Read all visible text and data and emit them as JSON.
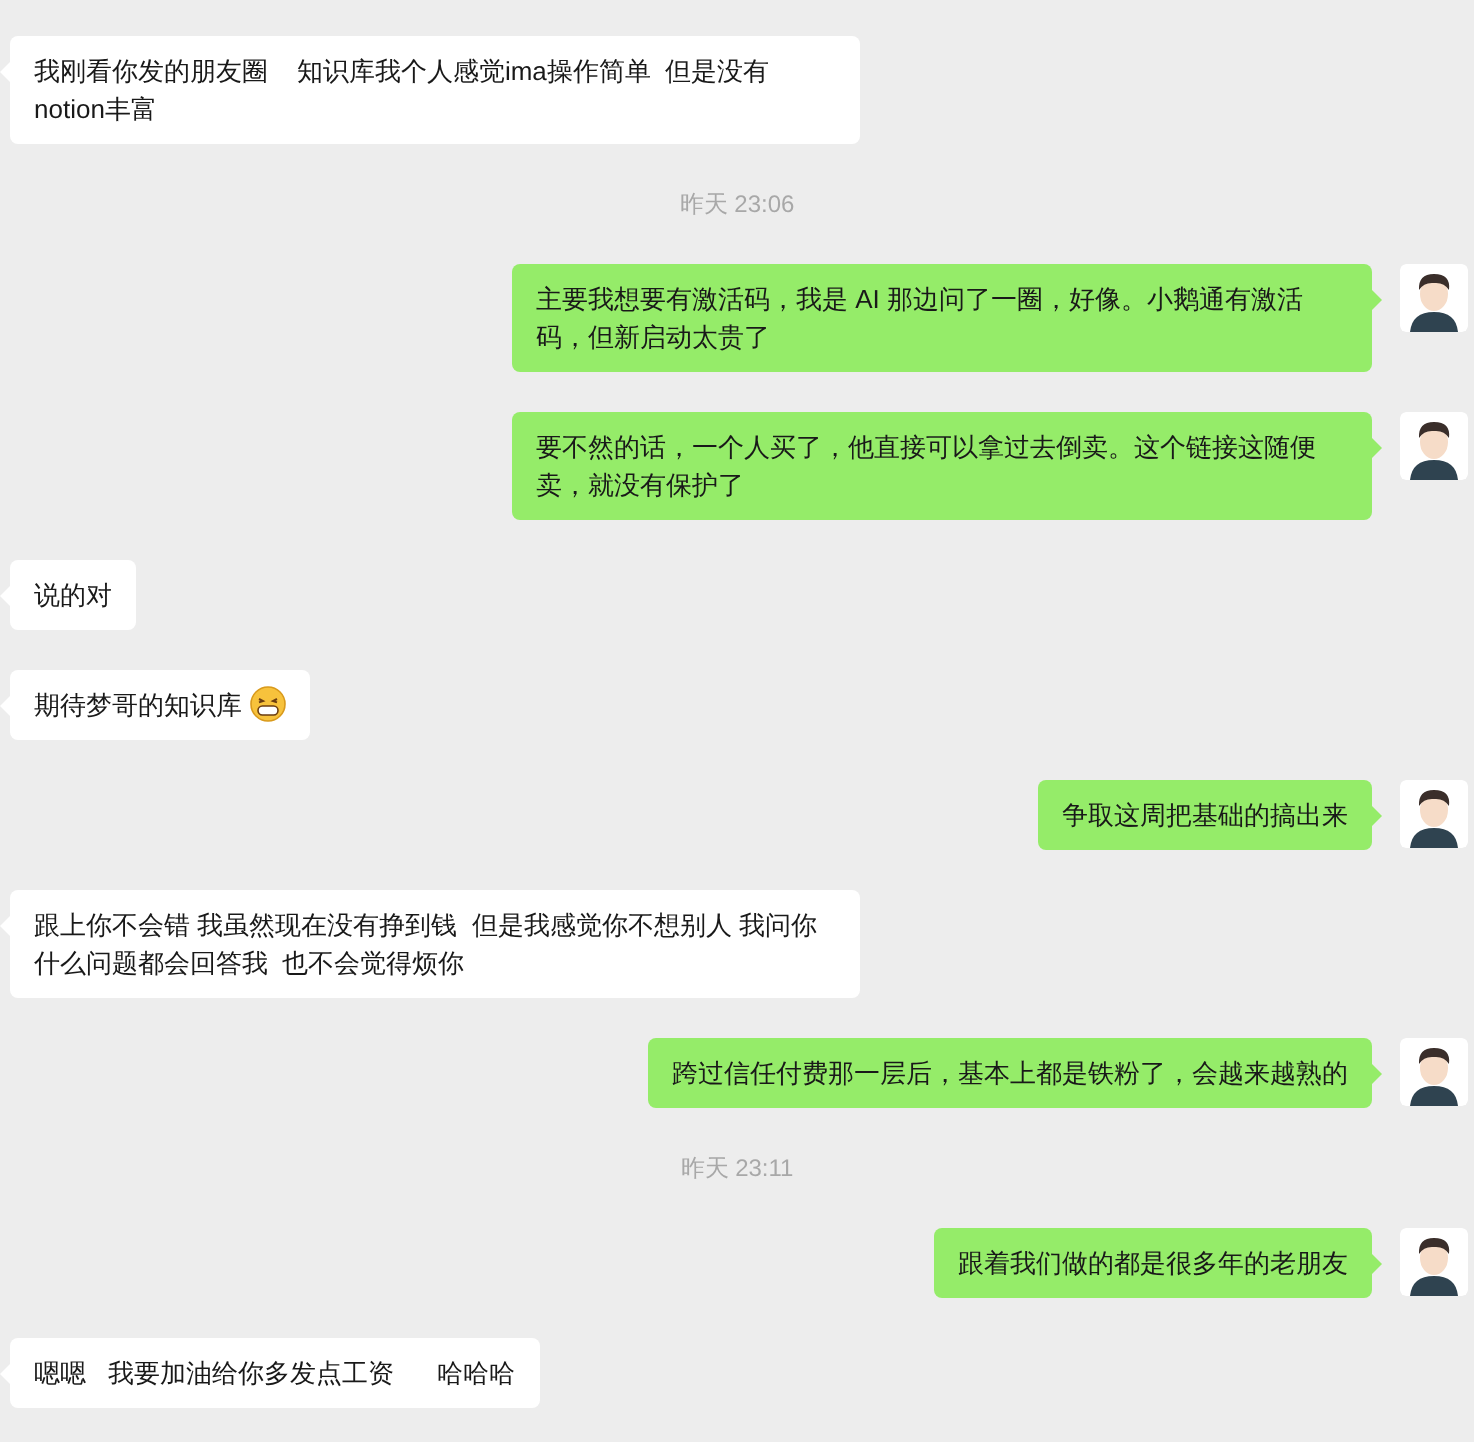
{
  "messages": [
    {
      "kind": "in",
      "text": "我刚看你发的朋友圈    知识库我个人感觉ima操作简单  但是没有notion丰富"
    },
    {
      "kind": "time",
      "text": "昨天 23:06"
    },
    {
      "kind": "out",
      "text": "主要我想要有激活码，我是 AI 那边问了一圈，好像。小鹅通有激活码，但新启动太贵了"
    },
    {
      "kind": "out",
      "text": "要不然的话，一个人买了，他直接可以拿过去倒卖。这个链接这随便卖，就没有保护了"
    },
    {
      "kind": "in",
      "text": "说的对"
    },
    {
      "kind": "in",
      "text": "期待梦哥的知识库",
      "emoji": true
    },
    {
      "kind": "out",
      "text": "争取这周把基础的搞出来"
    },
    {
      "kind": "in",
      "text": "跟上你不会错 我虽然现在没有挣到钱  但是我感觉你不想别人 我问你什么问题都会回答我  也不会觉得烦你"
    },
    {
      "kind": "out",
      "text": "跨过信任付费那一层后，基本上都是铁粉了，会越来越熟的"
    },
    {
      "kind": "time",
      "text": "昨天 23:11"
    },
    {
      "kind": "out",
      "text": "跟着我们做的都是很多年的老朋友"
    },
    {
      "kind": "in",
      "text": "嗯嗯   我要加油给你多发点工资      哈哈哈"
    }
  ]
}
